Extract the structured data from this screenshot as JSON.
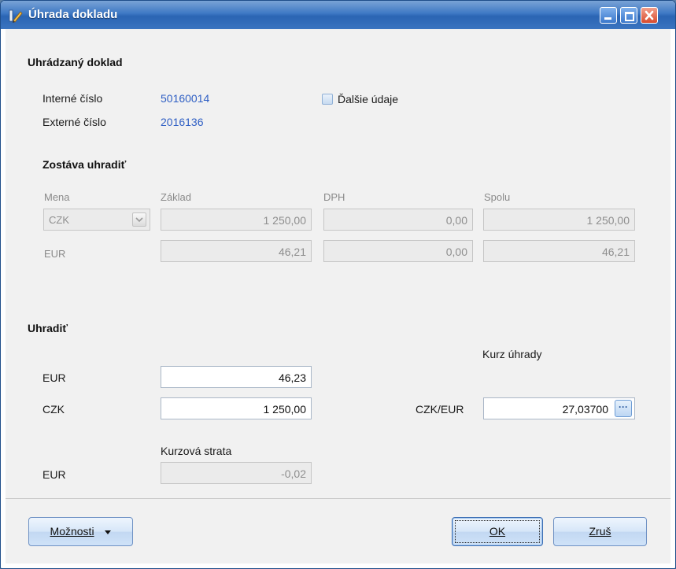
{
  "window": {
    "title": "Úhrada dokladu",
    "colors": {
      "titlebar": "#3d78c4",
      "link": "#2f5fc4",
      "close": "#d84b2e"
    }
  },
  "document": {
    "heading": "Uhrádzaný doklad",
    "internal_label": "Interné číslo",
    "internal_value": "50160014",
    "external_label": "Externé číslo",
    "external_value": "2016136",
    "more_details_label": "Ďalšie údaje",
    "more_details_checked": false
  },
  "remaining": {
    "heading": "Zostáva uhradiť",
    "columns": {
      "currency": "Mena",
      "base": "Základ",
      "vat": "DPH",
      "total": "Spolu"
    },
    "row1": {
      "currency": "CZK",
      "base": "1 250,00",
      "vat": "0,00",
      "total": "1 250,00"
    },
    "row2": {
      "currency": "EUR",
      "base": "46,21",
      "vat": "0,00",
      "total": "46,21"
    }
  },
  "pay": {
    "heading": "Uhradiť",
    "eur_label": "EUR",
    "eur_value": "46,23",
    "czk_label": "CZK",
    "czk_value": "1 250,00",
    "rate_heading": "Kurz úhrady",
    "rate_label": "CZK/EUR",
    "rate_value": "27,03700",
    "loss_heading": "Kurzová strata",
    "loss_label": "EUR",
    "loss_value": "-0,02"
  },
  "footer": {
    "options_label": "Možnosti",
    "ok_label": "OK",
    "cancel_label": "Zruš"
  },
  "icons": [
    "pencil-icon",
    "minimize-icon",
    "maximize-icon",
    "close-icon",
    "dropdown-arrow-icon",
    "ellipsis-icon",
    "caret-down-icon"
  ]
}
